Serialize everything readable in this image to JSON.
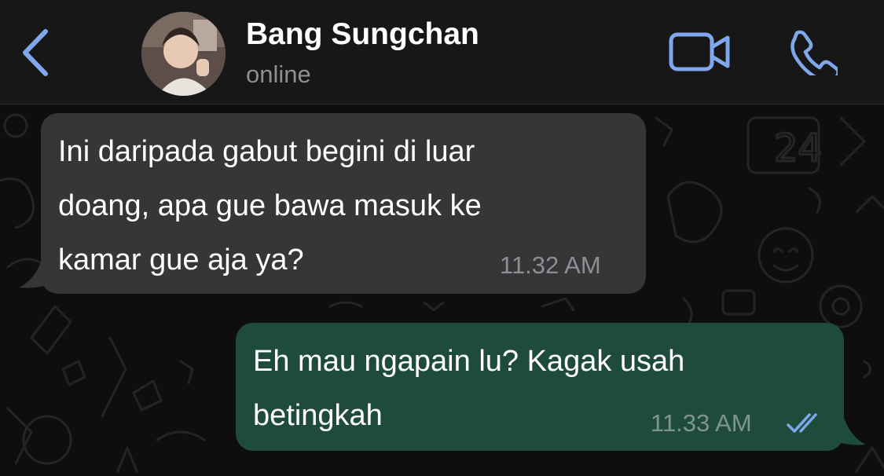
{
  "header": {
    "contact_name": "Bang Sungchan",
    "status": "online",
    "back_icon": "chevron-left-icon",
    "video_icon": "video-camera-icon",
    "phone_icon": "phone-icon"
  },
  "messages": [
    {
      "direction": "incoming",
      "text": "Ini daripada gabut begini di luar\ndoang, apa gue bawa masuk ke\nkamar gue aja ya?",
      "time": "11.32 AM"
    },
    {
      "direction": "outgoing",
      "text": "Eh mau ngapain lu? Kagak usah\nbetingkah",
      "time": "11.33 AM",
      "read_receipt_icon": "double-check-icon"
    }
  ],
  "colors": {
    "accent": "#7ea7ec",
    "incoming_bubble": "#363638",
    "outgoing_bubble": "#1f4b3d",
    "read_ticks": "#7ea7ec"
  }
}
